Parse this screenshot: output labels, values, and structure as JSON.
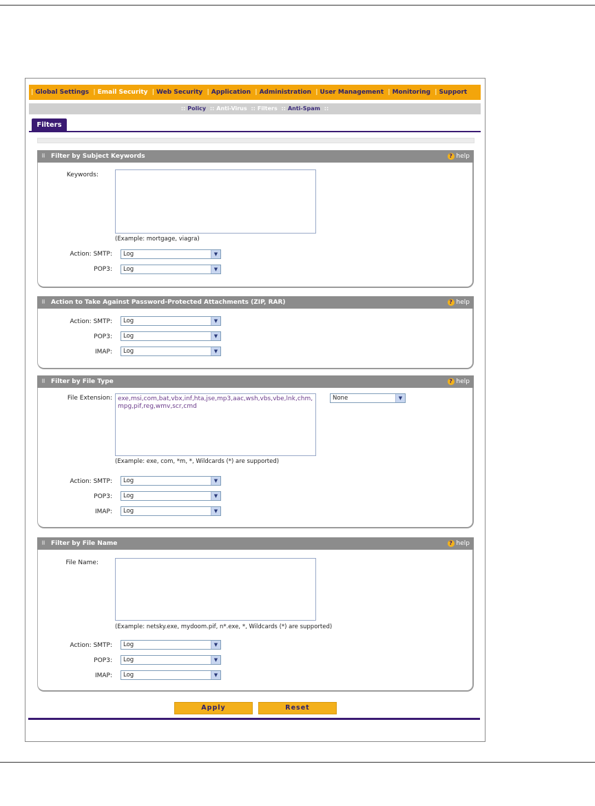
{
  "topnav": {
    "items": [
      "Global Settings",
      "Email Security",
      "Web Security",
      "Application",
      "Administration",
      "User Management",
      "Monitoring",
      "Support"
    ]
  },
  "subnav": {
    "items": [
      "Policy",
      "Anti-Virus",
      "Filters",
      "Anti-Spam"
    ]
  },
  "tab": {
    "label": "Filters"
  },
  "help_label": "help",
  "subject": {
    "title": "Filter by Subject Keywords",
    "keywords_label": "Keywords:",
    "keywords_value": "",
    "example": "(Example: mortgage, viagra)",
    "action_smtp_label": "Action: SMTP:",
    "smtp_value": "Log",
    "pop3_label": "POP3:",
    "pop3_value": "Log"
  },
  "password": {
    "title": "Action to Take Against Password-Protected Attachments (ZIP, RAR)",
    "action_smtp_label": "Action: SMTP:",
    "smtp_value": "Log",
    "pop3_label": "POP3:",
    "pop3_value": "Log",
    "imap_label": "IMAP:",
    "imap_value": "Log"
  },
  "filetype": {
    "title": "Filter by File Type",
    "ext_label": "File Extension:",
    "ext_value": "exe,msi,com,bat,vbx,inf,hta,jse,mp3,aac,wsh,vbs,vbe,lnk,chm,mpg,pif,reg,wmv,scr,cmd",
    "preset_value": "None",
    "example": "(Example: exe, com, *m, *, Wildcards (*) are supported)",
    "action_smtp_label": "Action: SMTP:",
    "smtp_value": "Log",
    "pop3_label": "POP3:",
    "pop3_value": "Log",
    "imap_label": "IMAP:",
    "imap_value": "Log"
  },
  "filename": {
    "title": "Filter by File Name",
    "name_label": "File Name:",
    "name_value": "",
    "example": "(Example: netsky.exe, mydoom.pif, n*.exe, *, Wildcards (*) are supported)",
    "action_smtp_label": "Action: SMTP:",
    "smtp_value": "Log",
    "pop3_label": "POP3:",
    "pop3_value": "Log",
    "imap_label": "IMAP:",
    "imap_value": "Log"
  },
  "buttons": {
    "apply": "Apply",
    "reset": "Reset"
  },
  "colors": {
    "nav_bg": "#f3a50b",
    "accent": "#3a1a72",
    "section_header": "#8c8c8c",
    "button": "#f3b01b"
  }
}
